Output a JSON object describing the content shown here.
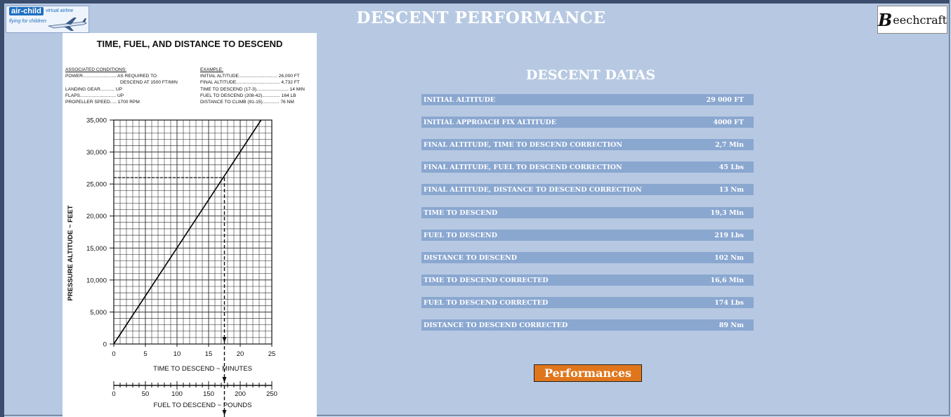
{
  "logos": {
    "left": {
      "brand": "air-child",
      "brand2": "virtual airline",
      "tagline": "flying for children"
    },
    "right": {
      "initial": "B",
      "rest": "eechcraft"
    }
  },
  "header": {
    "title": "DESCENT PERFORMANCE"
  },
  "chart": {
    "title": "TIME, FUEL, AND DISTANCE TO DESCEND",
    "conditions_heading": "ASSOCIATED CONDITIONS:",
    "conditions": [
      "POWER.......................... AS REQUIRED TO",
      "DESCEND AT 1500 FT/MIN",
      "LANDING GEAR........... UP",
      "FLAPS............................ UP",
      "PROPELLER SPEED..... 1700 RPM"
    ],
    "example_heading": "EXAMPLE:",
    "example": [
      "INITIAL ALTITUDE.............................. 26,000 FT",
      "FINAL ALTITUDE.................................. 4,732 FT",
      "TIME TO DESCEND (17-3)......................... 14 MIN",
      "FUEL TO DESCEND (208-42).............. 164 LB",
      "DISTANCE TO CLIMB (91-15)............. 76 NM"
    ]
  },
  "chart_data": {
    "type": "line",
    "ylabel": "PRESSURE ALTITUDE ~ FEET",
    "xlabel": "TIME TO DESCEND ~ MINUTES",
    "x2label": "FUEL TO DESCEND ~ POUNDS",
    "ylim": [
      0,
      35000
    ],
    "xlim": [
      0,
      25
    ],
    "x2lim": [
      0,
      250
    ],
    "y_ticks": [
      "0",
      "5,000",
      "10,000",
      "15,000",
      "20,000",
      "25,000",
      "30,000",
      "35,000"
    ],
    "x_ticks": [
      "0",
      "5",
      "10",
      "15",
      "20",
      "25"
    ],
    "x2_ticks": [
      "0",
      "50",
      "100",
      "150",
      "200",
      "250"
    ],
    "grid": true,
    "series": [
      {
        "values": [
          [
            0,
            0
          ],
          [
            23.3,
            35000
          ]
        ]
      }
    ],
    "example_line": {
      "altitude": 26000,
      "time": 17.5,
      "fuel": 200
    }
  },
  "descent": {
    "title": "DESCENT DATAS",
    "rows": [
      {
        "label": "INITIAL ALTITUDE",
        "value": "29 000 FT"
      },
      {
        "label": "INITIAL APPROACH FIX ALTITUDE",
        "value": "4000 FT"
      },
      {
        "label": "FINAL ALTITUDE, TIME TO DESCEND CORRECTION",
        "value": "2,7 Min"
      },
      {
        "label": "FINAL ALTITUDE, FUEL TO DESCEND CORRECTION",
        "value": "45 Lbs"
      },
      {
        "label": "FINAL ALTITUDE, DISTANCE TO DESCEND CORRECTION",
        "value": "13 Nm"
      },
      {
        "label": "TIME TO DESCEND",
        "value": "19,3 Min"
      },
      {
        "label": "FUEL TO DESCEND",
        "value": "219 Lbs"
      },
      {
        "label": "DISTANCE TO DESCEND",
        "value": "102 Nm"
      },
      {
        "label": "TIME TO DESCEND CORRECTED",
        "value": "16,6 Min"
      },
      {
        "label": "FUEL TO DESCEND CORRECTED",
        "value": "174 Lbs"
      },
      {
        "label": "DISTANCE TO DESCEND CORRECTED",
        "value": "89 Nm"
      }
    ]
  },
  "button": {
    "label": "Performances",
    "color": "#e0761c"
  },
  "colors": {
    "background": "#b7c9e2",
    "row": "#8aa7d0"
  }
}
